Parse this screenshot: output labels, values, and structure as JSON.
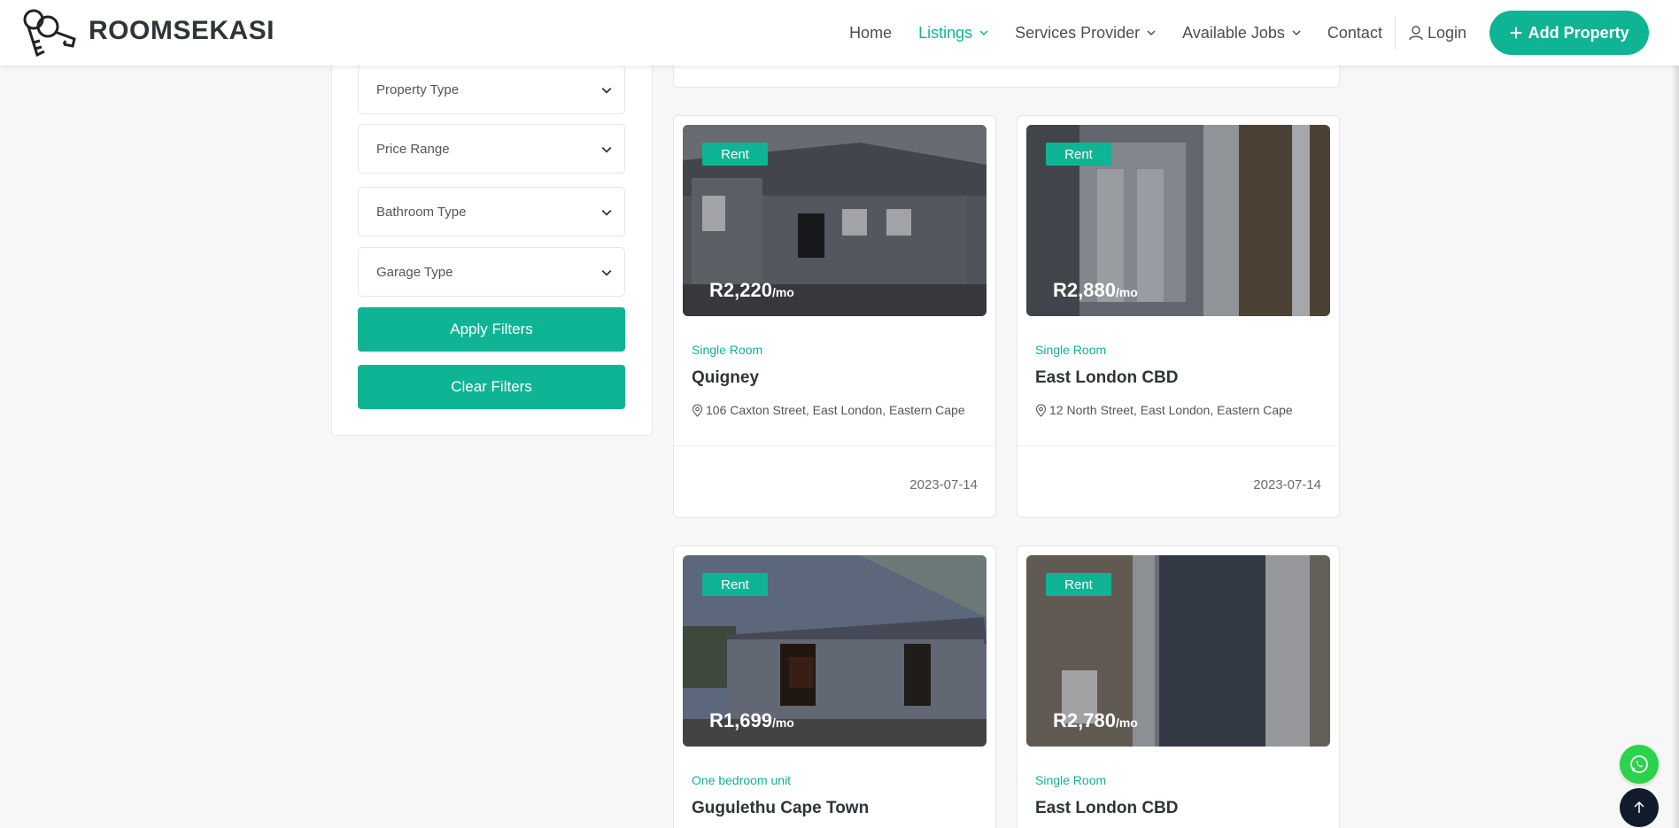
{
  "brand": {
    "name": "ROOMSEKASI",
    "accent_color": "#0fb494"
  },
  "nav": {
    "items": [
      {
        "label": "Home",
        "has_dropdown": false,
        "active": false
      },
      {
        "label": "Listings",
        "has_dropdown": true,
        "active": true
      },
      {
        "label": "Services Provider",
        "has_dropdown": true,
        "active": false
      },
      {
        "label": "Available Jobs",
        "has_dropdown": true,
        "active": false
      },
      {
        "label": "Contact",
        "has_dropdown": false,
        "active": false
      }
    ],
    "login_label": "Login",
    "add_property_label": "Add Property"
  },
  "filters": {
    "selects": [
      "Property Type",
      "Price Range",
      "Bathroom Type",
      "Garage Type"
    ],
    "apply_label": "Apply Filters",
    "clear_label": "Clear Filters"
  },
  "listings": [
    {
      "badge": "Rent",
      "price": "R2,220",
      "price_unit": "/mo",
      "type": "Single Room",
      "title": "Quigney",
      "address": "106 Caxton Street, East London, Eastern Cape",
      "date": "2023-07-14"
    },
    {
      "badge": "Rent",
      "price": "R2,880",
      "price_unit": "/mo",
      "type": "Single Room",
      "title": "East London CBD",
      "address": "12 North Street, East London, Eastern Cape",
      "date": "2023-07-14"
    },
    {
      "badge": "Rent",
      "price": "R1,699",
      "price_unit": "/mo",
      "type": "One bedroom unit",
      "title": "Gugulethu Cape Town",
      "address": "",
      "date": ""
    },
    {
      "badge": "Rent",
      "price": "R2,780",
      "price_unit": "/mo",
      "type": "Single Room",
      "title": "East London CBD",
      "address": "",
      "date": ""
    }
  ],
  "floating": {
    "whatsapp_icon": "whatsapp-icon",
    "back_to_top_icon": "arrow-up-icon"
  }
}
